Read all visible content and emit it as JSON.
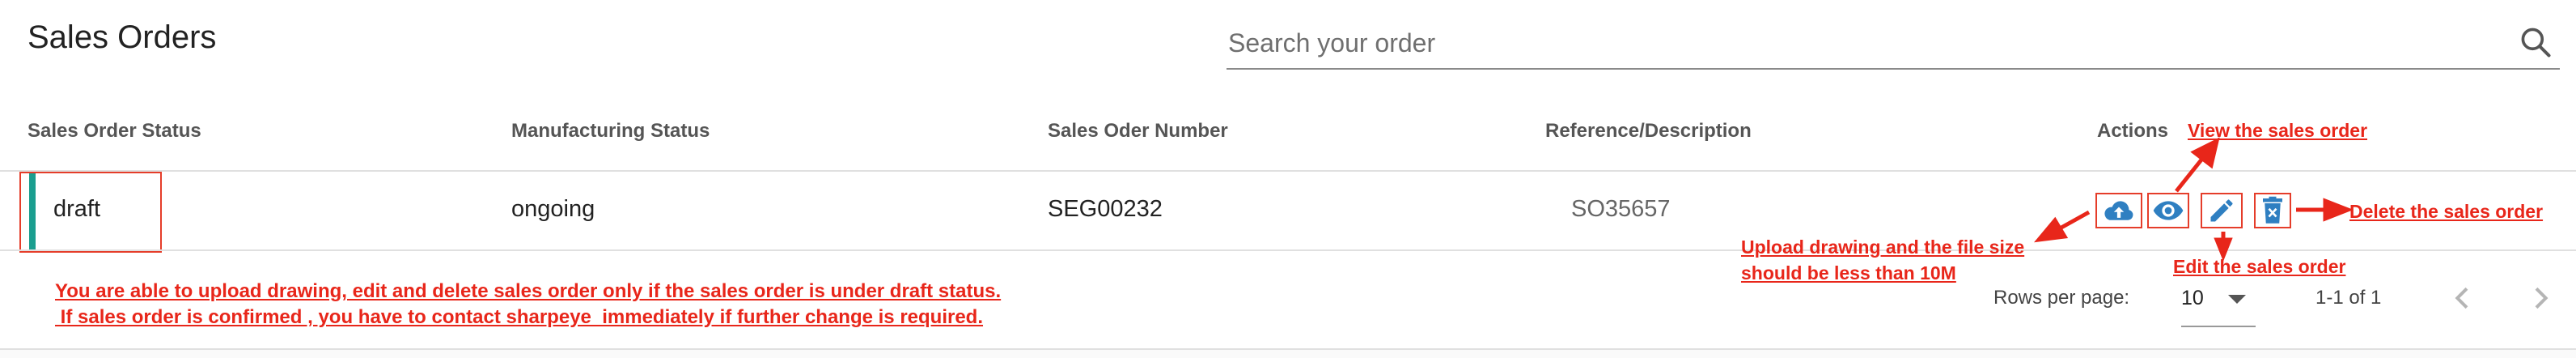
{
  "header": {
    "title": "Sales Orders",
    "search_placeholder": "Search your order"
  },
  "table": {
    "columns": [
      "Sales Order Status",
      "Manufacturing Status",
      "Sales Oder Number",
      "Reference/Description",
      "Actions"
    ],
    "rows": [
      {
        "sales_order_status": "draft",
        "manufacturing_status": "ongoing",
        "sales_order_number": "SEG00232",
        "reference": "SO35657"
      }
    ],
    "action_icons": [
      "upload-icon",
      "eye-icon",
      "pencil-icon",
      "delete-icon"
    ]
  },
  "annotations": {
    "view": "View the sales order",
    "delete": "Delete the sales order",
    "edit": "Edit the sales order",
    "upload_line1": "Upload drawing and the file size",
    "upload_line2": "should be less than 10M",
    "note_line1": "You are able to upload drawing, edit and delete sales order only if the sales order is under draft status.",
    "note_line2": " If sales order is confirmed , you have to contact sharpeye  immediately if further change is required."
  },
  "pagination": {
    "rows_per_page_label": "Rows per page:",
    "rows_per_page_value": "10",
    "range_text": "1-1 of 1"
  },
  "colors": {
    "accent_teal": "#1a9e8f",
    "icon_blue": "#2f7fc1",
    "annotation_red": "#e8261a"
  }
}
